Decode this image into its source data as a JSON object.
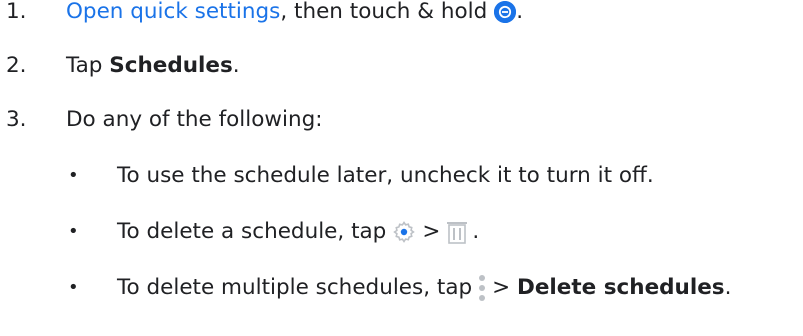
{
  "steps": [
    {
      "number": "1.",
      "link_text": "Open quick settings",
      "text_after_link": ", then touch & hold",
      "icon": "do-not-disturb-icon",
      "end": "."
    },
    {
      "number": "2.",
      "prefix": "Tap ",
      "bold": "Schedules",
      "end": "."
    },
    {
      "number": "3.",
      "text": "Do any of the following:"
    }
  ],
  "bullets": [
    {
      "marker": "•",
      "text": "To use the schedule later, uncheck it to turn it off."
    },
    {
      "marker": "•",
      "prefix": "To delete a schedule, tap",
      "icon1": "gear-icon",
      "separator": ">",
      "icon2": "trash-icon",
      "end": "."
    },
    {
      "marker": "•",
      "prefix": "To delete multiple schedules, tap",
      "icon": "more-vert-icon",
      "separator": "> ",
      "bold": "Delete schedules",
      "end": "."
    }
  ],
  "colors": {
    "link": "#1a73e8",
    "icon_accent": "#1a73e8",
    "icon_gray": "#bdc1c6",
    "text": "#202124"
  }
}
